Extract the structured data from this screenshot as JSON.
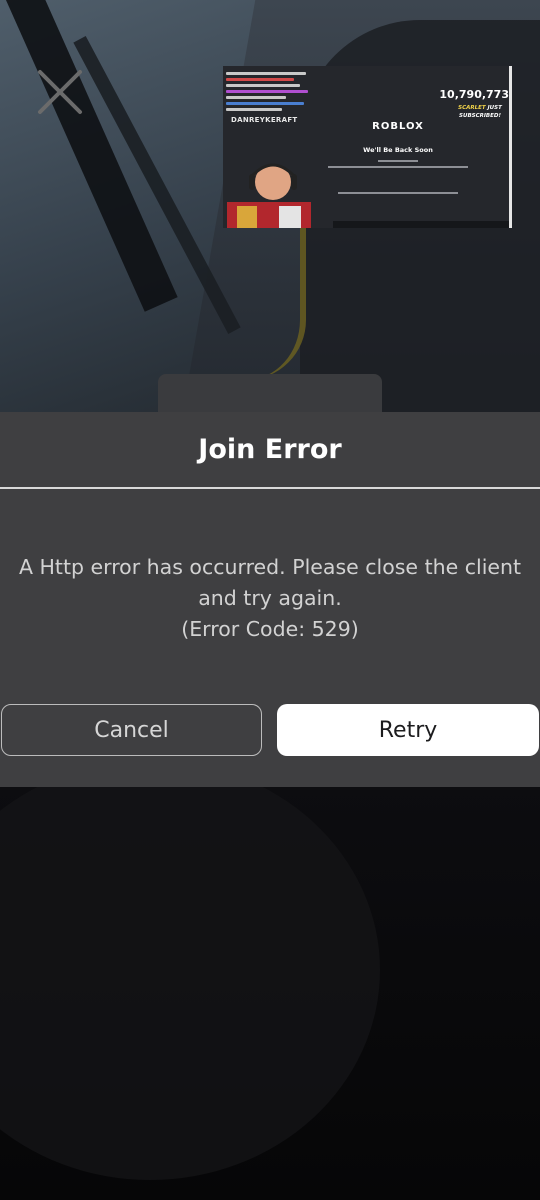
{
  "dialog": {
    "title": "Join Error",
    "message_line1": "A Http error has occurred. Please close the client",
    "message_line2": "and try again.",
    "message_line3": "(Error Code: 529)",
    "cancel_label": "Cancel",
    "retry_label": "Retry"
  },
  "thumbnail": {
    "channel_name": "DANREYKERAFT",
    "subscriber_count": "10,790,773",
    "subscribed_name": "SCARLET",
    "subscribed_text": "JUST SUBSCRIBED!",
    "platform_logo": "ROBLOX",
    "notice_title": "We'll Be Back Soon"
  },
  "colors": {
    "dialog_bg": "#3f3f41",
    "retry_bg": "#ffffff",
    "cancel_border": "#bcbcbc",
    "highlight": "#f2d44a"
  },
  "icons": {
    "close": "close-icon"
  }
}
